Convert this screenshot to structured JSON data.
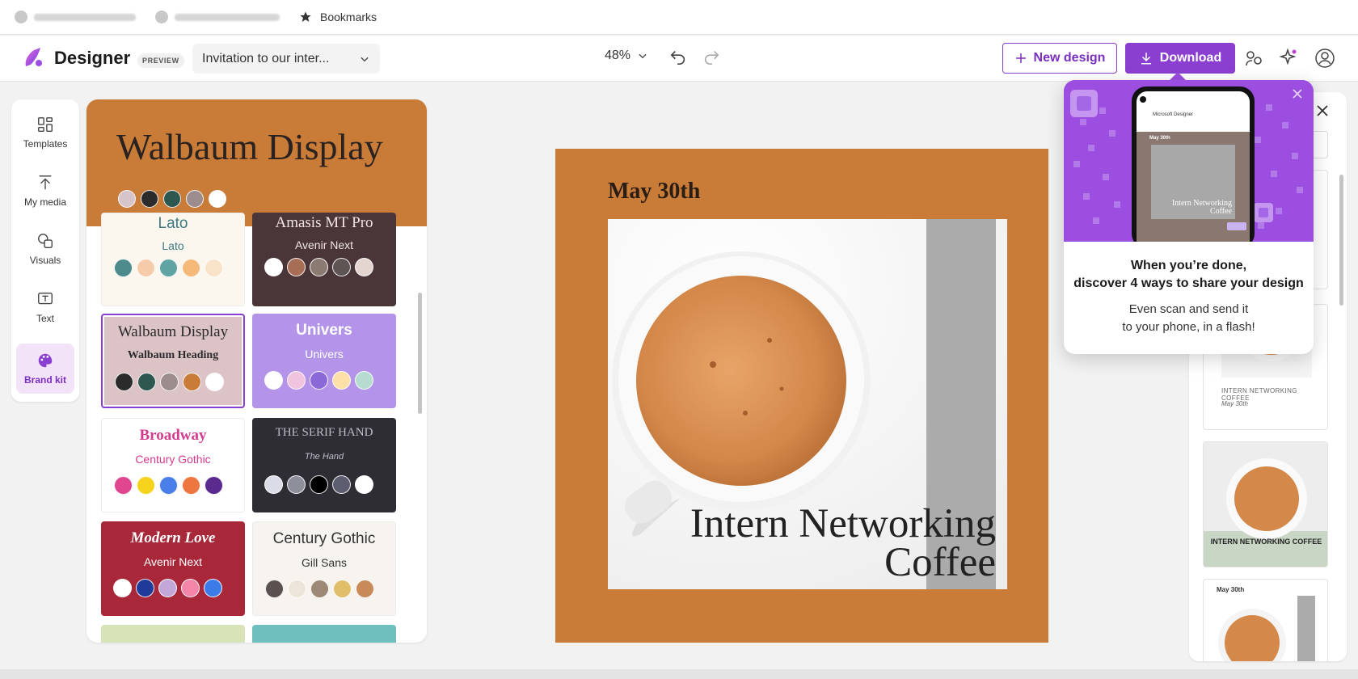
{
  "bookmarks": {
    "label": "Bookmarks"
  },
  "header": {
    "app_name": "Designer",
    "badge": "PREVIEW",
    "document_title": "Invitation to our inter...",
    "zoom": "48%",
    "new_design_label": "New design",
    "download_label": "Download"
  },
  "rail": {
    "templates": "Templates",
    "my_media": "My media",
    "visuals": "Visuals",
    "text": "Text",
    "brand_kit": "Brand kit"
  },
  "brand_panel": {
    "hero_title": "Walbaum Display",
    "hero_colors": [
      "#d7c3ca",
      "#2b2b2b",
      "#2e5750",
      "#9c8c8e",
      "#ffffff"
    ],
    "cards": [
      {
        "heading": "Lato",
        "body": "Lato",
        "bg": "#fbf7ef",
        "fg": "#3f7a80",
        "colors": [
          "#4d8a8c",
          "#f6cba9",
          "#5fa3a3",
          "#f5b97a",
          "#f8e3c8"
        ]
      },
      {
        "heading": "Amasis MT Pro",
        "body": "Avenir Next",
        "bg": "#4a3538",
        "fg": "#f0e6e2",
        "colors": [
          "#ffffff",
          "#a86e55",
          "#8a7a72",
          "#5e5453",
          "#e5d5d0"
        ]
      },
      {
        "heading": "Walbaum Display",
        "body": "Walbaum Heading",
        "bg": "#dcc3c6",
        "fg": "#2b2b2b",
        "colors": [
          "#2b2b2b",
          "#2e5750",
          "#9c8c8e",
          "#c97b38",
          "#ffffff"
        ]
      },
      {
        "heading": "Univers",
        "body": "Univers",
        "bg": "#b394e8",
        "fg": "#ffffff",
        "colors": [
          "#ffffff",
          "#f0c3df",
          "#8a68d8",
          "#fde0a7",
          "#b6dcd1"
        ]
      },
      {
        "heading": "Broadway",
        "body": "Century Gothic",
        "bg": "#ffffff",
        "fg": "#d43b8c",
        "colors": [
          "#e0468f",
          "#f5d31c",
          "#4a7ee8",
          "#ee7640",
          "#5a2a8f"
        ]
      },
      {
        "heading": "THE SERIF HAND",
        "body": "The Hand",
        "bg": "#2d2d33",
        "fg": "#bdbdc6",
        "colors": [
          "#dcdce8",
          "#8f8f9c",
          "#000000",
          "#5d5d70",
          "#ffffff"
        ]
      },
      {
        "heading": "Modern Love",
        "body": "Avenir Next",
        "bg": "#a8283a",
        "fg": "#ffffff",
        "colors": [
          "#ffffff",
          "#1f3a99",
          "#c2a7d8",
          "#f285a8",
          "#3d7be8"
        ]
      },
      {
        "heading": "Century Gothic",
        "body": "Gill Sans",
        "bg": "#f7f4ef",
        "fg": "#333333",
        "colors": [
          "#5a5050",
          "#ece6d8",
          "#9c8874",
          "#e0be6a",
          "#c98a5a"
        ]
      }
    ]
  },
  "canvas": {
    "date": "May 30th",
    "title_line1": "Intern Networking",
    "title_line2": "Coffee",
    "bg": "#c97b38"
  },
  "thumbnails": {
    "thumb2_title": "INTERN NETWORKING COFFEE",
    "thumb2_date": "May 30th",
    "thumb3_title": "INTERN NETWORKING COFFEE",
    "thumb4_date": "May 30th"
  },
  "popup": {
    "phone_header": "Microsoft Designer",
    "phone_date": "May 30th",
    "phone_title": "Intern Networking Coffee",
    "title_line1": "When you’re done,",
    "title_line2": "discover 4 ways to share your design",
    "body_line1": "Even scan and send it",
    "body_line2": "to your phone, in a flash!"
  },
  "colors": {
    "accent": "#8b3fd0",
    "canvas_orange": "#c97b38"
  }
}
